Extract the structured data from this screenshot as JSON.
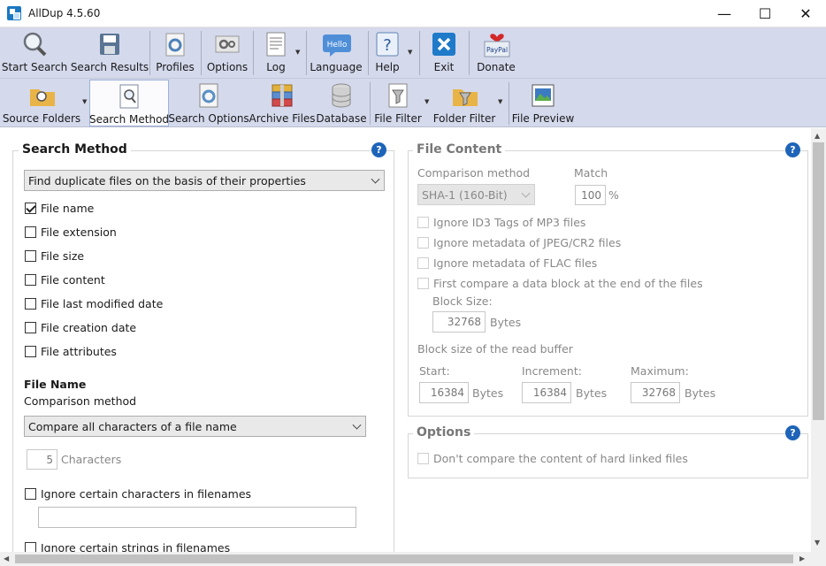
{
  "window": {
    "title": "AllDup 4.5.60",
    "minimize": "—",
    "maximize": "☐",
    "close": "✕"
  },
  "toolbar1": {
    "start_search": "Start Search",
    "search_results": "Search Results",
    "profiles": "Profiles",
    "options": "Options",
    "log": "Log",
    "language": "Language",
    "help": "Help",
    "exit": "Exit",
    "donate": "Donate",
    "language_icon_text": "Hello",
    "donate_icon_text": "PayPal"
  },
  "toolbar2": {
    "source_folders": "Source Folders",
    "search_method": "Search Method",
    "search_options": "Search Options",
    "archive_files": "Archive Files",
    "database": "Database",
    "file_filter": "File Filter",
    "folder_filter": "Folder Filter",
    "file_preview": "File Preview"
  },
  "search_method": {
    "title": "Search Method",
    "help": "?",
    "mode_select": "Find duplicate files on the basis of their properties",
    "criteria": [
      {
        "label": "File name",
        "checked": true
      },
      {
        "label": "File extension",
        "checked": false
      },
      {
        "label": "File size",
        "checked": false
      },
      {
        "label": "File content",
        "checked": false
      },
      {
        "label": "File last modified date",
        "checked": false
      },
      {
        "label": "File creation date",
        "checked": false
      },
      {
        "label": "File attributes",
        "checked": false
      }
    ],
    "file_name_heading": "File Name",
    "comparison_label": "Comparison method",
    "comparison_select": "Compare all characters of a file name",
    "characters_value": "5",
    "characters_label": "Characters",
    "ignore_chars": "Ignore certain characters in filenames",
    "ignore_chars_value": "",
    "ignore_strings": "Ignore certain strings in filenames"
  },
  "file_content": {
    "title": "File Content",
    "help": "?",
    "comparison_label": "Comparison method",
    "comparison_select": "SHA-1 (160-Bit)",
    "match_label": "Match",
    "match_value": "100",
    "match_unit": "%",
    "ignore_id3": "Ignore ID3 Tags of MP3 files",
    "ignore_jpeg": "Ignore metadata of JPEG/CR2 files",
    "ignore_flac": "Ignore metadata of FLAC files",
    "first_compare": "First compare a data block at the end of the files",
    "block_size_label": "Block Size:",
    "block_size_value": "32768",
    "bytes": "Bytes",
    "read_buffer_label": "Block size of the read buffer",
    "start_label": "Start:",
    "start_value": "16384",
    "increment_label": "Increment:",
    "increment_value": "16384",
    "maximum_label": "Maximum:",
    "maximum_value": "32768"
  },
  "options": {
    "title": "Options",
    "help": "?",
    "hard_links": "Don't compare the content of hard linked files"
  }
}
